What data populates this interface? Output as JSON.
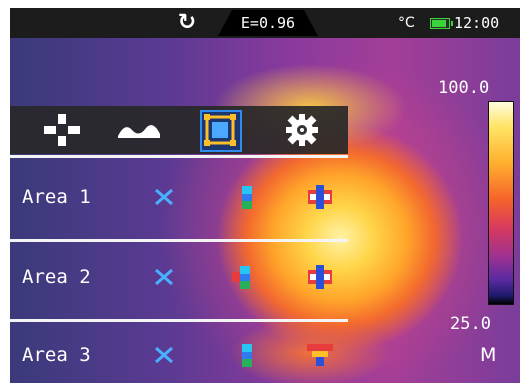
{
  "status": {
    "refresh_icon": "refresh-icon",
    "emissivity": "E=0.96",
    "unit": "°C",
    "battery_icon": "battery-icon",
    "time": "12:00"
  },
  "menu": {
    "items": [
      {
        "name": "crosshair-icon",
        "selected": false
      },
      {
        "name": "line-profile-icon",
        "selected": false
      },
      {
        "name": "area-icon",
        "selected": true
      },
      {
        "name": "settings-gear-icon",
        "selected": false
      }
    ]
  },
  "areas": [
    {
      "label": "Area 1",
      "icons": [
        "delete-x-icon",
        "area-temp-icon",
        "max-min-icon"
      ]
    },
    {
      "label": "Area 2",
      "icons": [
        "delete-x-icon",
        "area-temp-icon",
        "max-min-icon"
      ]
    },
    {
      "label": "Area 3",
      "icons": [
        "delete-x-icon",
        "area-temp-icon",
        "max-min-icon"
      ]
    }
  ],
  "scale": {
    "max": "100.0",
    "min": "25.0",
    "mode": "M",
    "colors": [
      "#fffce0",
      "#ffb02e",
      "#d83a5c",
      "#5a2aa0",
      "#000000"
    ]
  }
}
